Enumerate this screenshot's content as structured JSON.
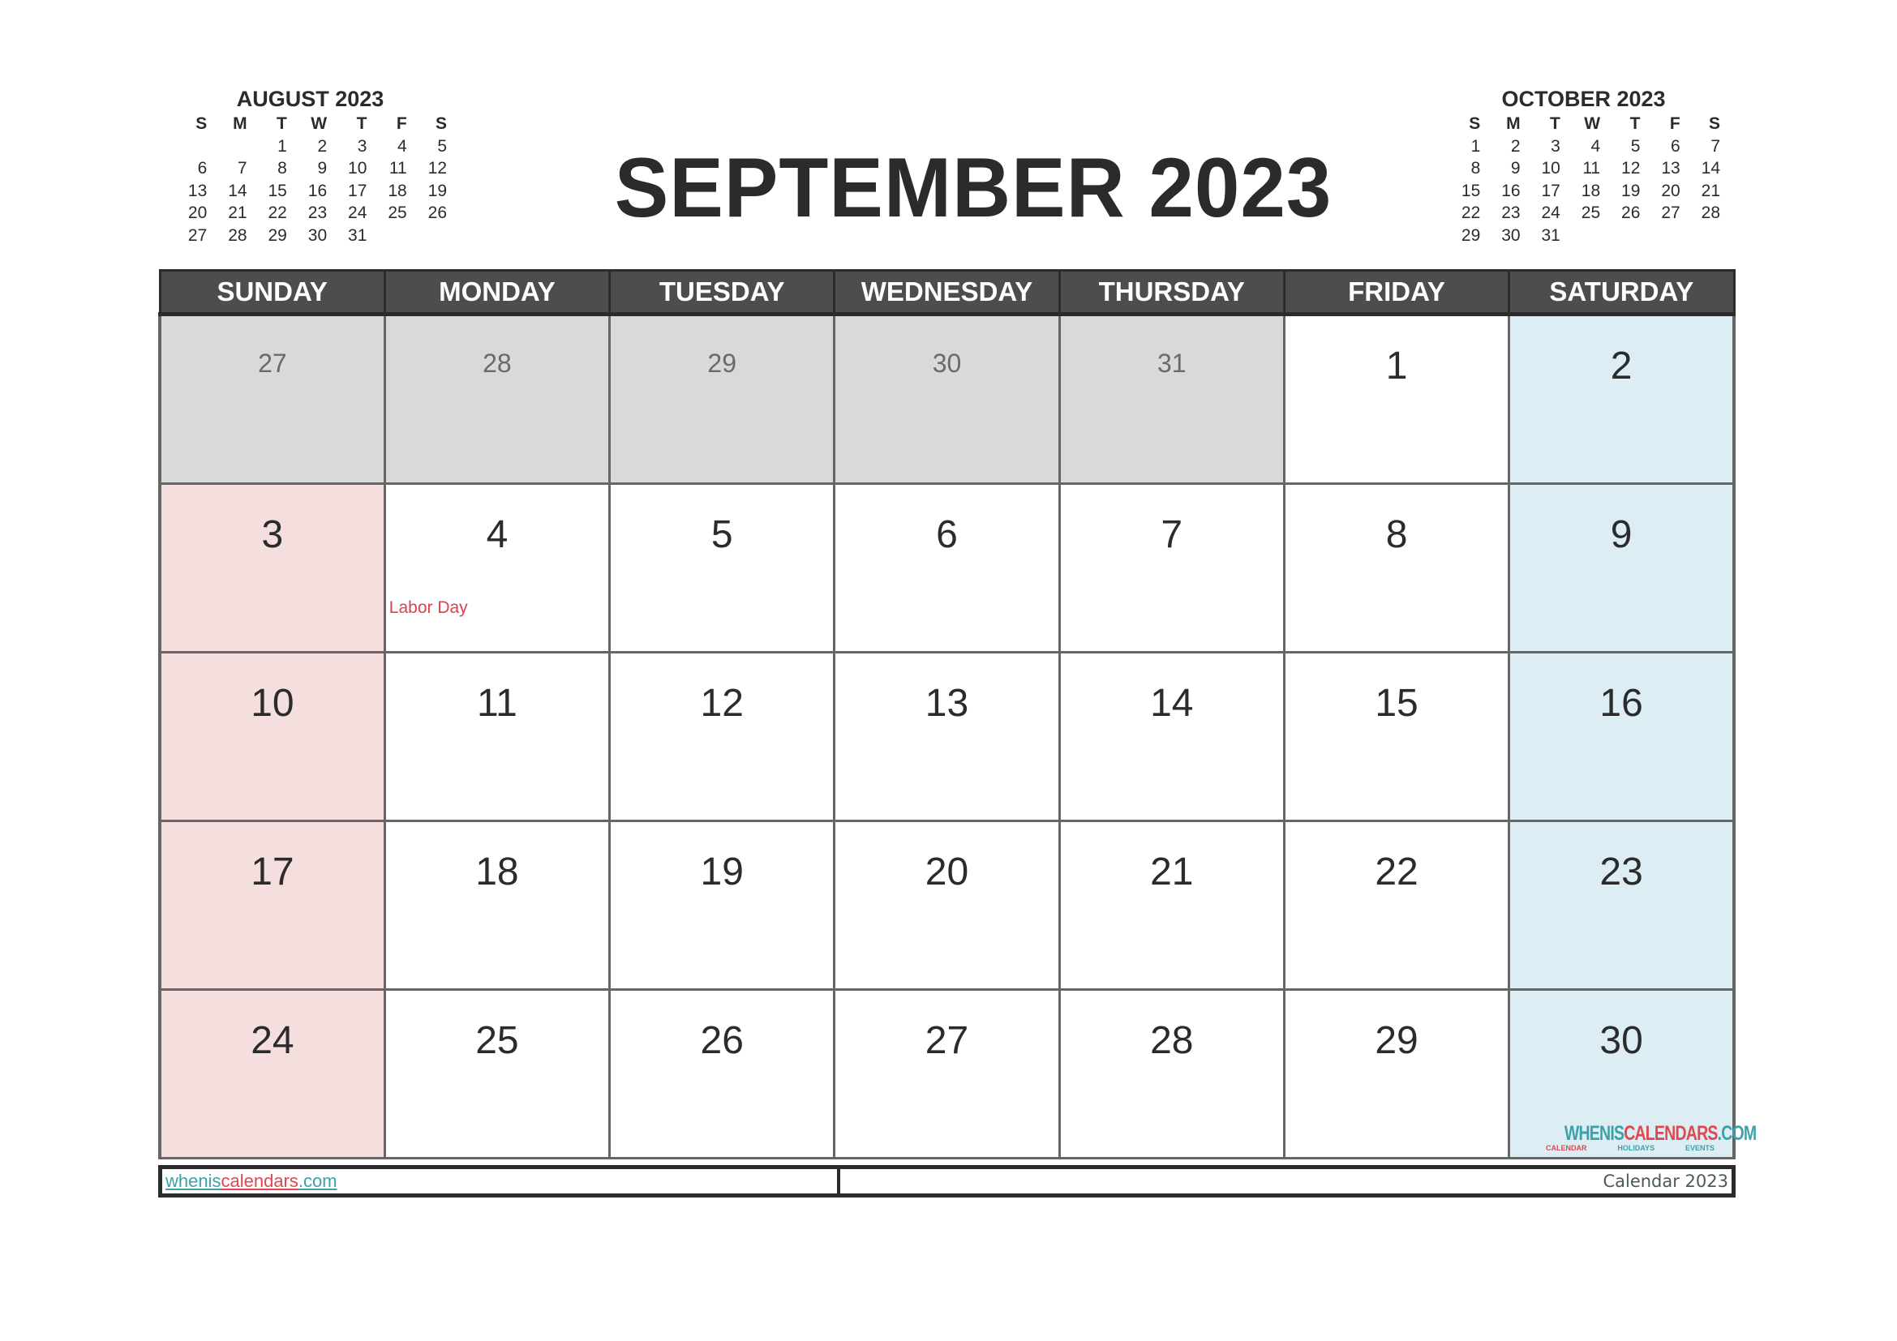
{
  "title": "SEPTEMBER 2023",
  "weekday_headers": [
    "SUNDAY",
    "MONDAY",
    "TUESDAY",
    "WEDNESDAY",
    "THURSDAY",
    "FRIDAY",
    "SATURDAY"
  ],
  "mini_weekday_headers": [
    "S",
    "M",
    "T",
    "W",
    "T",
    "F",
    "S"
  ],
  "prev_month": {
    "title": "AUGUST 2023",
    "weeks": [
      [
        "",
        "",
        "1",
        "2",
        "3",
        "4",
        "5"
      ],
      [
        "6",
        "7",
        "8",
        "9",
        "10",
        "11",
        "12"
      ],
      [
        "13",
        "14",
        "15",
        "16",
        "17",
        "18",
        "19"
      ],
      [
        "20",
        "21",
        "22",
        "23",
        "24",
        "25",
        "26"
      ],
      [
        "27",
        "28",
        "29",
        "30",
        "31",
        "",
        ""
      ]
    ]
  },
  "next_month": {
    "title": "OCTOBER 2023",
    "weeks": [
      [
        "1",
        "2",
        "3",
        "4",
        "5",
        "6",
        "7"
      ],
      [
        "8",
        "9",
        "10",
        "11",
        "12",
        "13",
        "14"
      ],
      [
        "15",
        "16",
        "17",
        "18",
        "19",
        "20",
        "21"
      ],
      [
        "22",
        "23",
        "24",
        "25",
        "26",
        "27",
        "28"
      ],
      [
        "29",
        "30",
        "31",
        "",
        "",
        "",
        ""
      ]
    ]
  },
  "weeks": [
    [
      {
        "day": "27",
        "prev": true
      },
      {
        "day": "28",
        "prev": true
      },
      {
        "day": "29",
        "prev": true
      },
      {
        "day": "30",
        "prev": true
      },
      {
        "day": "31",
        "prev": true
      },
      {
        "day": "1"
      },
      {
        "day": "2"
      }
    ],
    [
      {
        "day": "3"
      },
      {
        "day": "4",
        "holiday": "Labor Day"
      },
      {
        "day": "5"
      },
      {
        "day": "6"
      },
      {
        "day": "7"
      },
      {
        "day": "8"
      },
      {
        "day": "9"
      }
    ],
    [
      {
        "day": "10"
      },
      {
        "day": "11"
      },
      {
        "day": "12"
      },
      {
        "day": "13"
      },
      {
        "day": "14"
      },
      {
        "day": "15"
      },
      {
        "day": "16"
      }
    ],
    [
      {
        "day": "17"
      },
      {
        "day": "18"
      },
      {
        "day": "19"
      },
      {
        "day": "20"
      },
      {
        "day": "21"
      },
      {
        "day": "22"
      },
      {
        "day": "23"
      }
    ],
    [
      {
        "day": "24"
      },
      {
        "day": "25"
      },
      {
        "day": "26"
      },
      {
        "day": "27"
      },
      {
        "day": "28"
      },
      {
        "day": "29"
      },
      {
        "day": "30"
      }
    ]
  ],
  "logo": {
    "part1": "WHENIS",
    "part2": "CALENDARS",
    "part3": ".COM",
    "tags": [
      "CALENDAR",
      "HOLIDAYS",
      "EVENTS"
    ]
  },
  "footer": {
    "site_part1": "whenis",
    "site_part2": "calendars",
    "site_part3": ".com",
    "right_text": "Calendar 2023"
  },
  "colors": {
    "header_bg": "#4d4d4d",
    "prev_month_bg": "#d9d9d9",
    "sunday_bg": "#f5dede",
    "saturday_bg": "#dcedf4",
    "holiday_text": "#d9434e",
    "brand_teal": "#3aa2a8",
    "brand_red": "#e0474f"
  }
}
